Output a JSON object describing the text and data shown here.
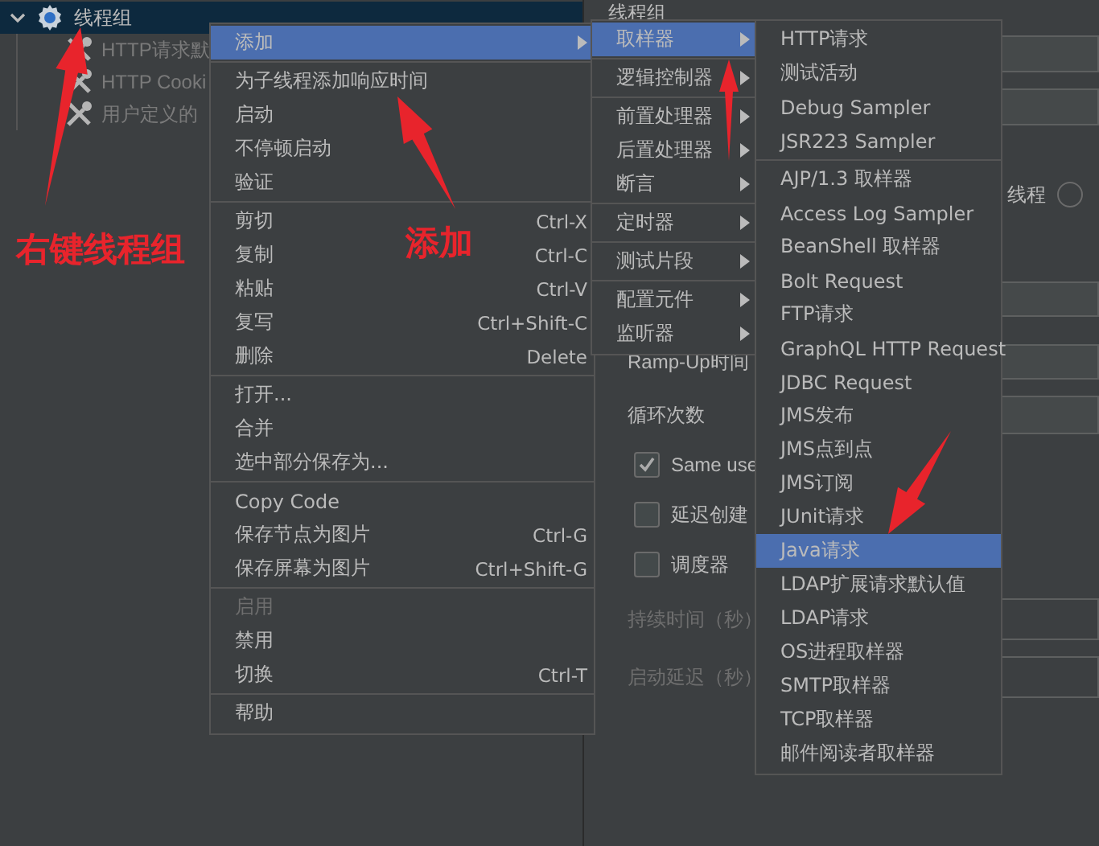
{
  "tree": [
    {
      "label": "线程组",
      "selected": true,
      "expanded": true,
      "children": [
        {
          "label": "HTTP请求默",
          "selected": false,
          "disabled": true
        },
        {
          "label": "HTTP Cooki",
          "selected": false,
          "disabled": true
        },
        {
          "label": "用户定义的",
          "selected": false,
          "disabled": true
        }
      ]
    }
  ],
  "form": {
    "title": "线程组",
    "rows": [
      {
        "kind": "input"
      },
      {
        "kind": "input"
      },
      {
        "kind": "radio",
        "label": "线程",
        "selected": false
      },
      {
        "kind": "input"
      },
      {
        "kind": "input",
        "label": "Ramp-Up时间"
      },
      {
        "kind": "input",
        "label": "循环次数"
      },
      {
        "kind": "checkbox",
        "label": "Same use",
        "checked": true
      },
      {
        "kind": "checkbox",
        "label": "延迟创建",
        "checked": false
      },
      {
        "kind": "checkbox",
        "label": "调度器",
        "checked": false
      },
      {
        "kind": "input",
        "label": "持续时间（秒）",
        "disabled": true
      },
      {
        "kind": "input",
        "label": "启动延迟（秒）",
        "disabled": true
      }
    ]
  },
  "context_menu": {
    "groups": [
      [
        {
          "label": "添加",
          "selected": true,
          "disabled": false,
          "submenu": true
        }
      ],
      [
        {
          "label": "为子线程添加响应时间",
          "selected": false,
          "disabled": false,
          "submenu": false
        },
        {
          "label": "启动",
          "selected": false,
          "disabled": false,
          "submenu": false
        },
        {
          "label": "不停顿启动",
          "selected": false,
          "disabled": false,
          "submenu": false
        },
        {
          "label": "验证",
          "selected": false,
          "disabled": false,
          "submenu": false
        }
      ],
      [
        {
          "label": "剪切",
          "shortcut": "Ctrl-X",
          "selected": false,
          "disabled": false,
          "submenu": false
        },
        {
          "label": "复制",
          "shortcut": "Ctrl-C",
          "selected": false,
          "disabled": false,
          "submenu": false
        },
        {
          "label": "粘贴",
          "shortcut": "Ctrl-V",
          "selected": false,
          "disabled": false,
          "submenu": false
        },
        {
          "label": "复写",
          "shortcut": "Ctrl+Shift-C",
          "selected": false,
          "disabled": false,
          "submenu": false
        },
        {
          "label": "删除",
          "shortcut": "Delete",
          "selected": false,
          "disabled": false,
          "submenu": false
        }
      ],
      [
        {
          "label": "打开...",
          "selected": false,
          "disabled": false,
          "submenu": false
        },
        {
          "label": "合并",
          "selected": false,
          "disabled": false,
          "submenu": false
        },
        {
          "label": "选中部分保存为...",
          "selected": false,
          "disabled": false,
          "submenu": false
        }
      ],
      [
        {
          "label": "Copy Code",
          "selected": false,
          "disabled": false,
          "submenu": false
        },
        {
          "label": "保存节点为图片",
          "shortcut": "Ctrl-G",
          "selected": false,
          "disabled": false,
          "submenu": false
        },
        {
          "label": "保存屏幕为图片",
          "shortcut": "Ctrl+Shift-G",
          "selected": false,
          "disabled": false,
          "submenu": false
        }
      ],
      [
        {
          "label": "启用",
          "selected": false,
          "disabled": true,
          "submenu": false
        },
        {
          "label": "禁用",
          "selected": false,
          "disabled": false,
          "submenu": false
        },
        {
          "label": "切换",
          "shortcut": "Ctrl-T",
          "selected": false,
          "disabled": false,
          "submenu": false
        }
      ],
      [
        {
          "label": "帮助",
          "selected": false,
          "disabled": false,
          "submenu": false
        }
      ]
    ]
  },
  "add_menu": {
    "groups": [
      [
        {
          "label": "取样器",
          "selected": true,
          "submenu": true
        }
      ],
      [
        {
          "label": "逻辑控制器",
          "selected": false,
          "submenu": true
        }
      ],
      [
        {
          "label": "前置处理器",
          "selected": false,
          "submenu": true
        },
        {
          "label": "后置处理器",
          "selected": false,
          "submenu": true
        },
        {
          "label": "断言",
          "selected": false,
          "submenu": true
        }
      ],
      [
        {
          "label": "定时器",
          "selected": false,
          "submenu": true
        }
      ],
      [
        {
          "label": "测试片段",
          "selected": false,
          "submenu": true
        }
      ],
      [
        {
          "label": "配置元件",
          "selected": false,
          "submenu": true
        },
        {
          "label": "监听器",
          "selected": false,
          "submenu": true
        }
      ]
    ]
  },
  "sampler_menu": {
    "groups": [
      [
        {
          "label": "HTTP请求",
          "selected": false
        },
        {
          "label": "测试活动",
          "selected": false
        },
        {
          "label": "Debug Sampler",
          "selected": false
        },
        {
          "label": "JSR223 Sampler",
          "selected": false
        }
      ],
      [
        {
          "label": "AJP/1.3 取样器",
          "selected": false
        },
        {
          "label": "Access Log Sampler",
          "selected": false
        },
        {
          "label": "BeanShell 取样器",
          "selected": false
        },
        {
          "label": "Bolt Request",
          "selected": false
        },
        {
          "label": "FTP请求",
          "selected": false
        },
        {
          "label": "GraphQL HTTP Request",
          "selected": false
        },
        {
          "label": "JDBC Request",
          "selected": false
        },
        {
          "label": "JMS发布",
          "selected": false
        },
        {
          "label": "JMS点到点",
          "selected": false
        },
        {
          "label": "JMS订阅",
          "selected": false
        },
        {
          "label": "JUnit请求",
          "selected": false
        },
        {
          "label": "Java请求",
          "selected": true
        },
        {
          "label": "LDAP扩展请求默认值",
          "selected": false
        },
        {
          "label": "LDAP请求",
          "selected": false
        },
        {
          "label": "OS进程取样器",
          "selected": false
        },
        {
          "label": "SMTP取样器",
          "selected": false
        },
        {
          "label": "TCP取样器",
          "selected": false
        },
        {
          "label": "邮件阅读者取样器",
          "selected": false
        }
      ]
    ]
  },
  "annotations": [
    {
      "label": "右键线程组"
    },
    {
      "label": "添加"
    }
  ]
}
